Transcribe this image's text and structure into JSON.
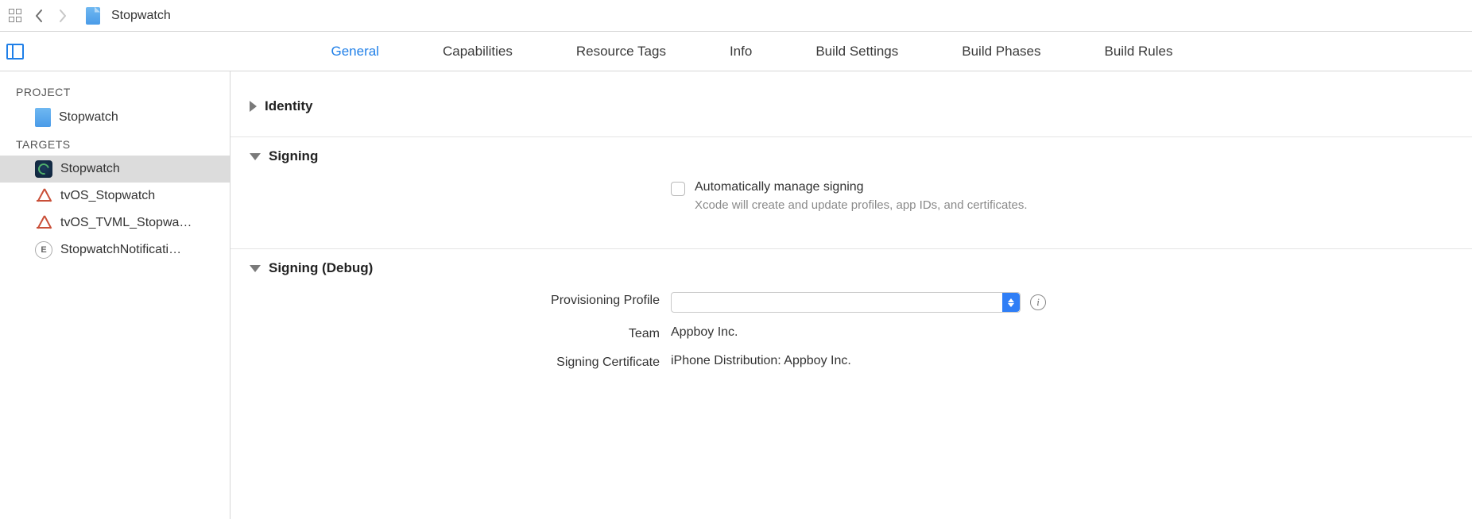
{
  "topbar": {
    "title": "Stopwatch"
  },
  "tabs": {
    "items": [
      {
        "label": "General",
        "active": true
      },
      {
        "label": "Capabilities"
      },
      {
        "label": "Resource Tags"
      },
      {
        "label": "Info"
      },
      {
        "label": "Build Settings"
      },
      {
        "label": "Build Phases"
      },
      {
        "label": "Build Rules"
      }
    ]
  },
  "sidebar": {
    "project_section": "PROJECT",
    "targets_section": "TARGETS",
    "project_item": "Stopwatch",
    "targets": [
      {
        "label": "Stopwatch",
        "kind": "app",
        "selected": true
      },
      {
        "label": "tvOS_Stopwatch",
        "kind": "tvos"
      },
      {
        "label": "tvOS_TVML_Stopwa…",
        "kind": "tvos"
      },
      {
        "label": "StopwatchNotificati…",
        "kind": "ext"
      }
    ]
  },
  "sections": {
    "identity": "Identity",
    "signing": {
      "title": "Signing",
      "auto_label": "Automatically manage signing",
      "auto_help": "Xcode will create and update profiles, app IDs, and certificates."
    },
    "signing_debug": {
      "title": "Signing (Debug)",
      "profile_label": "Provisioning Profile",
      "profile_value": "",
      "team_label": "Team",
      "team_value": "Appboy Inc.",
      "cert_label": "Signing Certificate",
      "cert_value": "iPhone Distribution: Appboy Inc."
    }
  }
}
